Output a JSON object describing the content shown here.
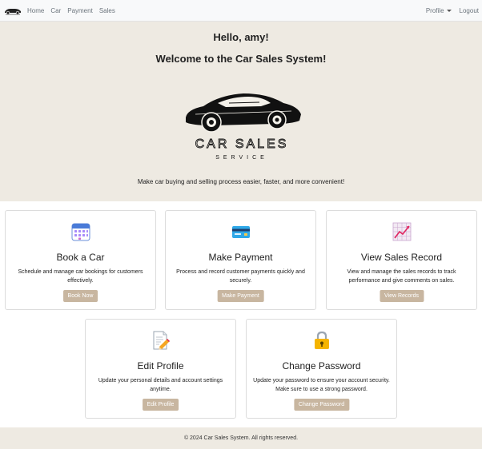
{
  "nav": {
    "logo_icon": "car-logo-icon",
    "links": [
      "Home",
      "Car",
      "Payment",
      "Sales"
    ],
    "profile_label": "Profile",
    "logout_label": "Logout"
  },
  "hero": {
    "greeting": "Hello, amy!",
    "welcome": "Welcome to the Car Sales System!",
    "logo_text_main": "CAR SALES",
    "logo_text_sub": "SERVICE",
    "tagline": "Make car buying and selling process easier, faster, and more convenient!"
  },
  "cards": [
    {
      "icon": "calendar-icon",
      "title": "Book a Car",
      "text": "Schedule and manage car bookings for customers effectively.",
      "button": "Book Now"
    },
    {
      "icon": "credit-card-icon",
      "title": "Make Payment",
      "text": "Process and record customer payments quickly and securely.",
      "button": "Make Payment"
    },
    {
      "icon": "chart-icon",
      "title": "View Sales Record",
      "text": "View and manage the sales records to track performance and give comments on sales.",
      "button": "View Records"
    },
    {
      "icon": "edit-document-icon",
      "title": "Edit Profile",
      "text": "Update your personal details and account settings anytime.",
      "button": "Edit Profile"
    },
    {
      "icon": "lock-icon",
      "title": "Change Password",
      "text": "Update your password to ensure your account security. Make sure to use a strong password.",
      "button": "Change Password"
    }
  ],
  "footer": {
    "text": "© 2024 Car Sales System. All rights reserved."
  },
  "colors": {
    "hero_bg": "#eeeae2",
    "button_bg": "#c8b6a0",
    "navbar_bg": "#f8f9fa"
  }
}
